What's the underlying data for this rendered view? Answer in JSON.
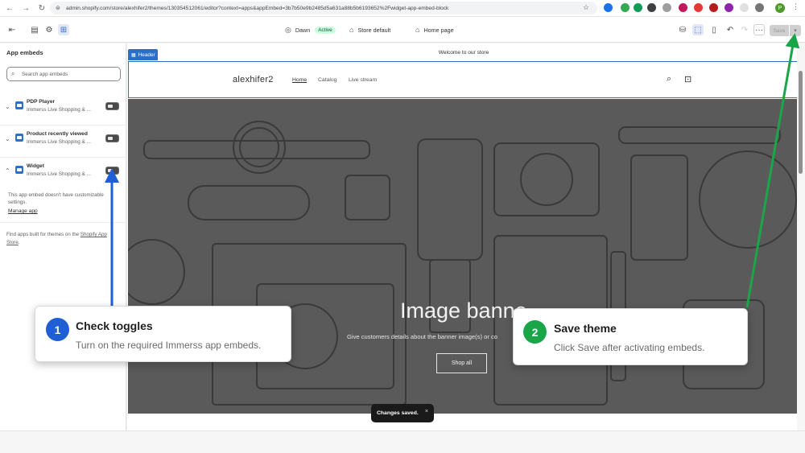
{
  "browser": {
    "url": "admin.shopify.com/store/alexhifer2/themes/130354512061/editor?context=apps&appEmbed=3b7b50e9b2485d5a631a88b5b6193652%2Fwidget-app-embed-block",
    "profile_initial": "P"
  },
  "topbar": {
    "theme_name": "Dawn",
    "theme_status": "Active",
    "store_default": "Store default",
    "home_page": "Home page",
    "more": "···",
    "save_label": "Save"
  },
  "sidebar": {
    "title": "App embeds",
    "search_placeholder": "Search app embeds",
    "embeds": [
      {
        "name": "PDP Player",
        "app": "Immerss Live Shopping & ..."
      },
      {
        "name": "Product recently viewed",
        "app": "Immerss Live Shopping & ..."
      },
      {
        "name": "Widget",
        "app": "Immerss Live Shopping & ..."
      }
    ],
    "no_settings": "This app embed doesn't have customizable settings.",
    "manage_app": "Manage app",
    "footer_text": "Find apps built for themes on the",
    "footer_link": "Shopify App",
    "footer_link2": "Store",
    "footer_end": "."
  },
  "preview": {
    "announcement": "Welcome to our store",
    "section_tag": "Header",
    "brand": "alexhifer2",
    "nav": [
      "Home",
      "Catalog",
      "Live stream"
    ],
    "banner_title": "Image banne",
    "banner_subtitle": "Give customers details about the banner image(s) or co",
    "banner_button": "Shop all"
  },
  "toast": {
    "text": "Changes saved.",
    "close": "×"
  },
  "callouts": [
    {
      "number": "1",
      "title": "Check toggles",
      "subtitle": "Turn on the required Immerss app embeds.",
      "color": "#1f5fd6"
    },
    {
      "number": "2",
      "title": "Save theme",
      "subtitle": "Click Save after activating embeds.",
      "color": "#1aa548"
    }
  ],
  "colors": {
    "accent": "#2c6ecb",
    "arrow_blue": "#1f5fd6",
    "arrow_green": "#1aa548"
  }
}
